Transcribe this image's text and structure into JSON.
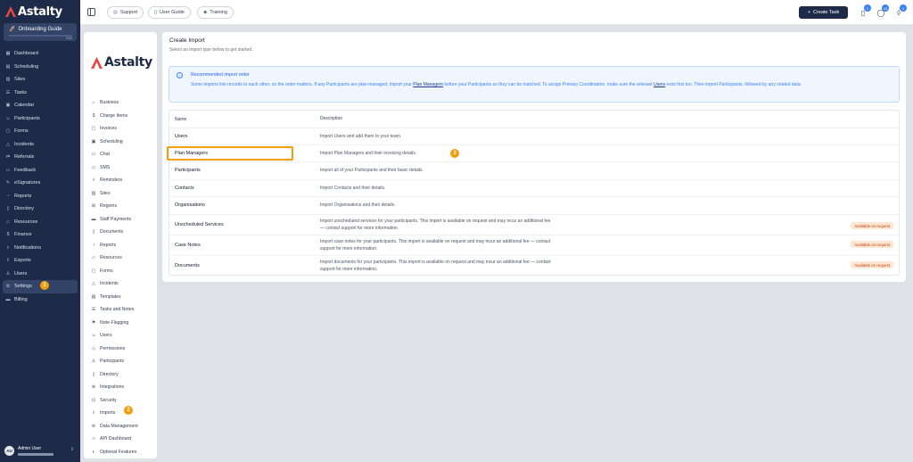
{
  "app": {
    "brand": "Astalty",
    "onboarding_label": "Onboarding Guide",
    "onboarding_progress": "0/30"
  },
  "sidebar": {
    "items": [
      {
        "label": "Dashboard",
        "icon": "grid-icon"
      },
      {
        "label": "Scheduling",
        "icon": "calendar-grid-icon"
      },
      {
        "label": "Sites",
        "icon": "building-icon"
      },
      {
        "label": "Tasks",
        "icon": "list-icon"
      },
      {
        "label": "Calendar",
        "icon": "calendar-icon"
      },
      {
        "label": "Participants",
        "icon": "users-icon"
      },
      {
        "label": "Forms",
        "icon": "form-icon"
      },
      {
        "label": "Incidents",
        "icon": "warning-icon"
      },
      {
        "label": "Referrals",
        "icon": "referral-icon"
      },
      {
        "label": "Feedback",
        "icon": "chat-icon"
      },
      {
        "label": "eSignatures",
        "icon": "pen-icon"
      },
      {
        "label": "Reports",
        "icon": "chart-icon"
      },
      {
        "label": "Directory",
        "icon": "book-icon"
      },
      {
        "label": "Resources",
        "icon": "folder-icon"
      },
      {
        "label": "Finance",
        "icon": "dollar-icon"
      },
      {
        "label": "Notifications",
        "icon": "bell-icon"
      },
      {
        "label": "Exports",
        "icon": "export-icon"
      },
      {
        "label": "Users",
        "icon": "user-icon"
      },
      {
        "label": "Settings",
        "icon": "gear-icon"
      },
      {
        "label": "Billing",
        "icon": "card-icon"
      }
    ],
    "settings_badge": "1"
  },
  "user": {
    "initials": "AU",
    "name": "Admin User"
  },
  "topbar": {
    "support_label": "Support",
    "guide_label": "User Guide",
    "training_label": "Training",
    "create_task_label": "Create Task",
    "badge_tasks": "1",
    "badge_messages": "10",
    "badge_notifications": "1"
  },
  "subnav": {
    "items": [
      {
        "label": "Business",
        "icon": "store-icon"
      },
      {
        "label": "Charge Items",
        "icon": "dollar-icon"
      },
      {
        "label": "Invoices",
        "icon": "invoice-icon"
      },
      {
        "label": "Scheduling",
        "icon": "calendar-icon"
      },
      {
        "label": "Chat",
        "icon": "chat-icon"
      },
      {
        "label": "SMS",
        "icon": "sms-icon"
      },
      {
        "label": "Reminders",
        "icon": "bell-icon"
      },
      {
        "label": "Sites",
        "icon": "building-icon"
      },
      {
        "label": "Regions",
        "icon": "map-icon"
      },
      {
        "label": "Staff Payments",
        "icon": "wallet-icon"
      },
      {
        "label": "Documents",
        "icon": "document-icon"
      },
      {
        "label": "Reports",
        "icon": "chart-icon"
      },
      {
        "label": "Resources",
        "icon": "folder-icon"
      },
      {
        "label": "Forms",
        "icon": "form-icon"
      },
      {
        "label": "Incidents",
        "icon": "warning-icon"
      },
      {
        "label": "Templates",
        "icon": "template-icon"
      },
      {
        "label": "Tasks and Notes",
        "icon": "list-icon"
      },
      {
        "label": "Note Flagging",
        "icon": "flag-icon"
      },
      {
        "label": "Users",
        "icon": "users-icon"
      },
      {
        "label": "Permissions",
        "icon": "shield-icon"
      },
      {
        "label": "Participants",
        "icon": "user-icon"
      },
      {
        "label": "Directory",
        "icon": "book-icon"
      },
      {
        "label": "Integrations",
        "icon": "plug-icon"
      },
      {
        "label": "Security",
        "icon": "lock-icon"
      },
      {
        "label": "Imports",
        "icon": "import-icon"
      },
      {
        "label": "Data Management",
        "icon": "database-icon"
      },
      {
        "label": "API Dashboard",
        "icon": "code-icon"
      },
      {
        "label": "Optional Features",
        "icon": "toggle-icon"
      }
    ],
    "imports_badge": "2"
  },
  "main": {
    "title": "Create Import",
    "subtitle": "Select an import type below to get started.",
    "notice_title": "Recommended import order",
    "notice_body_1": "Some imports link records to each other, so the order matters. If any Participants are plan-managed, import your ",
    "notice_link_1": "Plan Managers",
    "notice_body_2": " before your Participants so they can be matched. To assign Primary Coordinators, make sure the relevant ",
    "notice_link_2": "Users",
    "notice_body_3": " exist first too. Then import Participants, followed by any related data.",
    "col_name": "Name",
    "col_desc": "Description",
    "rows": [
      {
        "name": "Users",
        "desc": "Import Users and add them to your team."
      },
      {
        "name": "Plan Managers",
        "desc": "Import Plan Managers and their invoicing details."
      },
      {
        "name": "Participants",
        "desc": "Import all of your Participants and their basic details."
      },
      {
        "name": "Contacts",
        "desc": "Import Contacts and their details."
      },
      {
        "name": "Organisations",
        "desc": "Import Organisations and their details."
      },
      {
        "name": "Unscheduled Services",
        "desc": "Import unscheduled services for your participants. This import is available on request and may incur an additional fee — contact support for more information.",
        "tag": "Available on request"
      },
      {
        "name": "Case Notes",
        "desc": "Import case notes for your participants. This import is available on request and may incur an additional fee — contact support for more information.",
        "tag": "Available on request"
      },
      {
        "name": "Documents",
        "desc": "Import documents for your participants. This import is available on request and may incur an additional fee — contact support for more information.",
        "tag": "Available on request"
      }
    ],
    "step_badge": "3"
  },
  "colors": {
    "sidebar_bg": "#1d2b48",
    "accent_orange": "#f59e0b",
    "notice_blue": "#3b82f6"
  }
}
